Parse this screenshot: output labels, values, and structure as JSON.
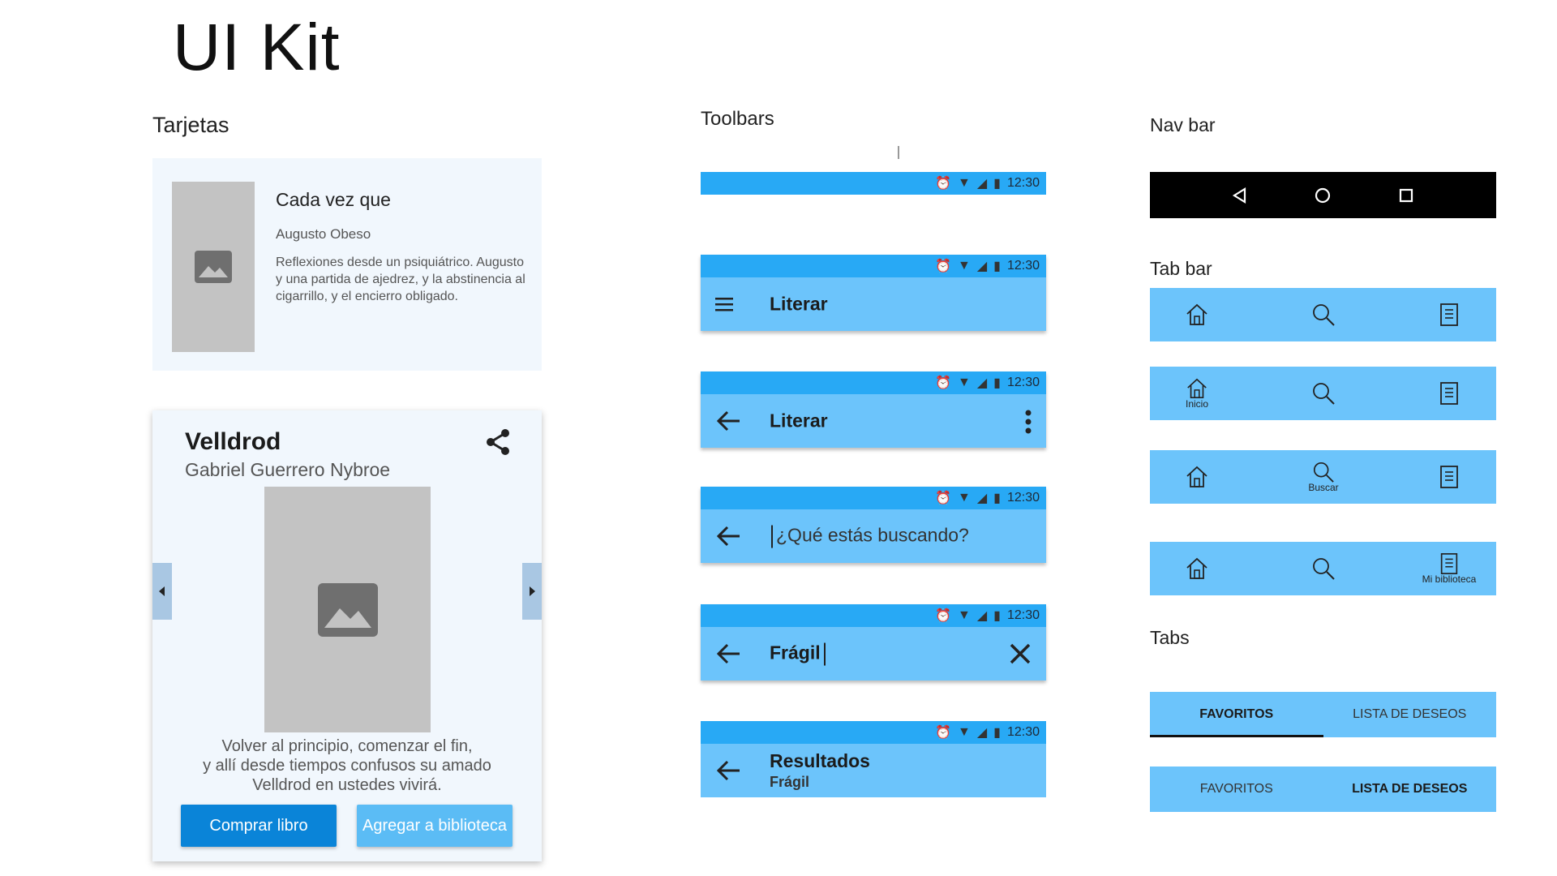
{
  "page_title": "UI Kit",
  "sections": {
    "cards": "Tarjetas",
    "toolbars": "Toolbars",
    "navbar": "Nav bar",
    "tabbar": "Tab bar",
    "tabs": "Tabs"
  },
  "card_small": {
    "title": "Cada vez que",
    "author": "Augusto Obeso",
    "description": "Reflexiones desde un psiquiátrico. Augusto y una partida de ajedrez, y la abstinencia al cigarrillo, y el encierro obligado."
  },
  "card_large": {
    "title": "Velldrod",
    "author": "Gabriel Guerrero Nybroe",
    "description_lines": [
      "Volver al principio, comenzar el fin,",
      "y allí desde tiempos confusos su amado",
      "Velldrod en ustedes vivirá."
    ],
    "buy_label": "Comprar libro",
    "add_label": "Agregar a biblioteca"
  },
  "status_time": "12:30",
  "toolbars": {
    "menu_title": "Literar",
    "back_title": "Literar",
    "search_placeholder": "¿Qué estás buscando?",
    "search_query": "Frágil",
    "results_title": "Resultados",
    "results_subtitle": "Frágil"
  },
  "tabbar_captions": {
    "home": "Inicio",
    "search": "Buscar",
    "library": "Mi biblioteca"
  },
  "tabs": {
    "favorites": "FAVORITOS",
    "wishlist": "LISTA DE DESEOS"
  },
  "colors": {
    "status_bar": "#28a9f5",
    "toolbar": "#6cc4fb",
    "primary_button": "#0a84d8",
    "secondary_button": "#5bbcf5",
    "card_background": "#f1f7fd"
  }
}
